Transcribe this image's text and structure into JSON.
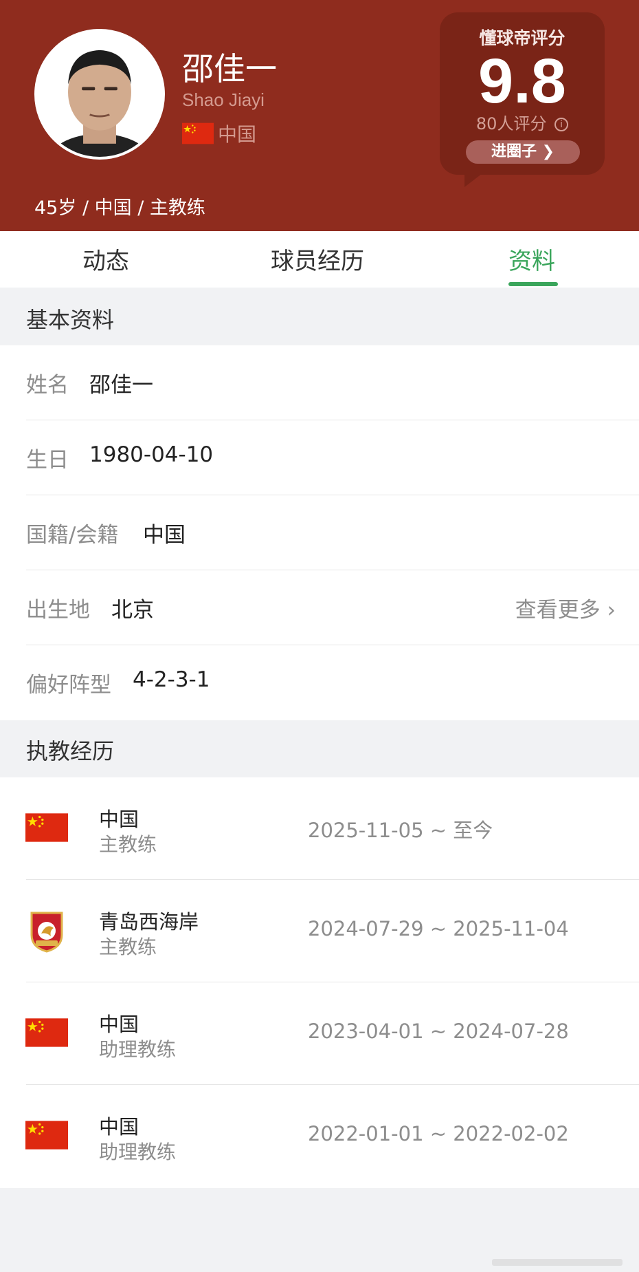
{
  "header": {
    "name_cn": "邵佳一",
    "name_en": "Shao Jiayi",
    "nation": "中国",
    "meta": "45岁 / 中国 / 主教练"
  },
  "rating": {
    "title": "懂球帝评分",
    "score": "9.8",
    "count": "80人评分",
    "info_glyph": "i",
    "circle_button": "进圈子 ❯"
  },
  "tabs": [
    {
      "label": "动态",
      "active": false
    },
    {
      "label": "球员经历",
      "active": false
    },
    {
      "label": "资料",
      "active": true
    }
  ],
  "basic": {
    "heading": "基本资料",
    "rows": [
      {
        "label": "姓名",
        "value": "邵佳一"
      },
      {
        "label": "生日",
        "value": "1980-04-10"
      },
      {
        "label": "国籍/会籍",
        "value": "中国"
      },
      {
        "label": "出生地",
        "value": "北京"
      },
      {
        "label": "偏好阵型",
        "value": "4-2-3-1"
      }
    ],
    "more": "查看更多 ›"
  },
  "coaching": {
    "heading": "执教经历",
    "rows": [
      {
        "team": "中国",
        "role": "主教练",
        "period": "2025-11-05 ~ 至今",
        "icon": "china-flag-icon"
      },
      {
        "team": "青岛西海岸",
        "role": "主教练",
        "period": "2024-07-29 ~ 2025-11-04",
        "icon": "qingdao-west-coast-crest-icon"
      },
      {
        "team": "中国",
        "role": "助理教练",
        "period": "2023-04-01 ~ 2024-07-28",
        "icon": "china-flag-icon"
      },
      {
        "team": "中国",
        "role": "助理教练",
        "period": "2022-01-01 ~ 2022-02-02",
        "icon": "china-flag-icon"
      }
    ]
  },
  "colors": {
    "header_bg": "#8f2c1e",
    "rating_card": "#7a2417",
    "accent_green": "#3aa55b",
    "flag_red": "#de2910",
    "flag_yellow": "#ffde00"
  }
}
